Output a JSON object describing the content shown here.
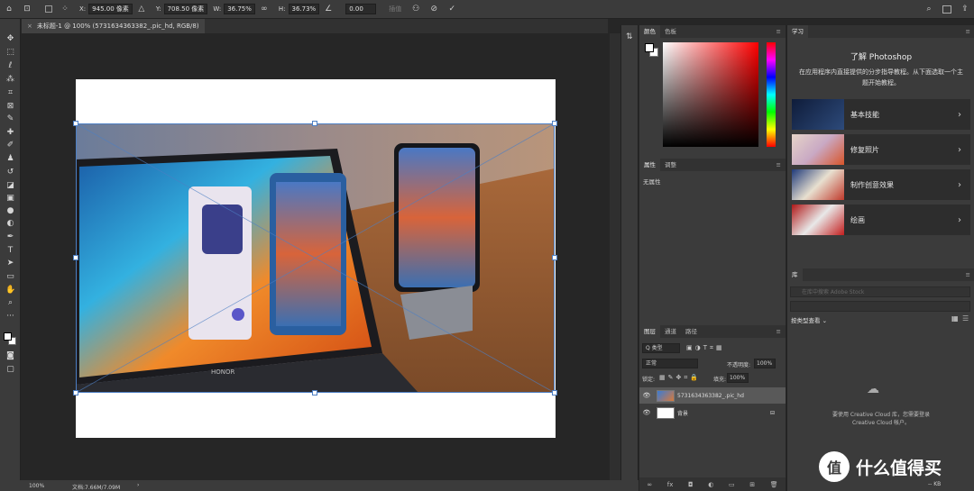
{
  "options_bar": {
    "x_label": "X:",
    "x_value": "945.00 像素",
    "y_label": "Y:",
    "y_value": "708.50 像素",
    "w_label": "W:",
    "w_value": "36.75%",
    "h_label": "H:",
    "h_value": "36.73%",
    "angle_value": "0.00",
    "hidden_option": "插值",
    "confirm_icon": "check-icon",
    "cancel_icon": "cancel-icon"
  },
  "document_tab": {
    "close": "×",
    "title": "未标题-1 @ 100% (5731634363382_.pic_hd, RGB/8)"
  },
  "status_bar": {
    "zoom": "100%",
    "doc_info": "文档:7.66M/7.09M",
    "arrow": "›"
  },
  "color_panel": {
    "tabs": [
      "颜色",
      "色板"
    ],
    "active_tab": "颜色"
  },
  "properties_panel": {
    "tabs": [
      "属性",
      "调整"
    ],
    "empty_text": "无属性"
  },
  "layers_panel": {
    "tabs": [
      "图层",
      "通道",
      "路径"
    ],
    "filter_label": "Q 类型",
    "blend_mode": "正常",
    "opacity_label": "不透明度:",
    "opacity_value": "100%",
    "lock_label": "锁定:",
    "fill_label": "填充:",
    "fill_value": "100%",
    "layers": [
      {
        "name": "5731634363382_.pic_hd",
        "visible": true,
        "selected": true
      },
      {
        "name": "背景",
        "visible": true,
        "selected": false,
        "locked": true
      }
    ]
  },
  "learn_panel": {
    "tab": "学习",
    "title": "了解 Photoshop",
    "description": "在应用程序内直接提供的分步指导教程。从下面选取一个主题开始教程。",
    "cards": [
      {
        "label": "基本技能"
      },
      {
        "label": "修复照片"
      },
      {
        "label": "制作创意效果"
      },
      {
        "label": "绘画"
      }
    ]
  },
  "library_panel": {
    "tab": "库",
    "search_placeholder": "在库中搜索 Adobe Stock",
    "view_by": "按类型查看",
    "cc_message": "要使用 Creative Cloud 库，您需要登录 Creative Cloud 帐户。",
    "size": "-- KB"
  },
  "watermark": {
    "text": "什么值得买"
  },
  "colors": {
    "accent": "#1473e6",
    "panel_bg": "#3b3b3b",
    "canvas_bg": "#262626"
  }
}
